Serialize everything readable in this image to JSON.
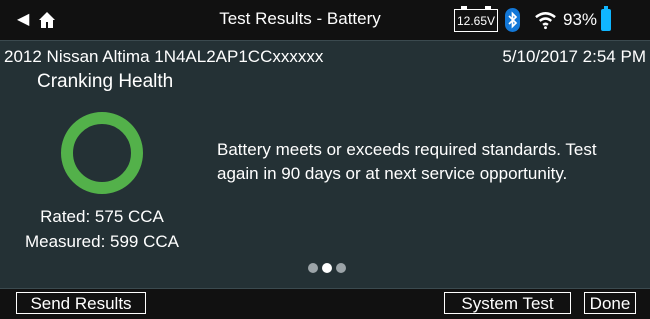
{
  "app": {
    "title": "Test Results - Battery",
    "voltage": "12.65V",
    "wifi_strength": "full",
    "battery_percent": "93%",
    "battery_level": 0.93,
    "back_icon": "back-arrow-icon",
    "home_icon": "home-icon"
  },
  "vehicle": {
    "info": "2012 Nissan Altima 1N4AL2AP1CCxxxxxx",
    "datetime": "5/10/2017  2:54 PM"
  },
  "result": {
    "section_title": "Cranking Health",
    "status_color": "#53b14a",
    "message": "Battery meets or exceeds required standards. Test again in 90 days or at next service opportunity.",
    "rated": "Rated: 575 CCA",
    "measured": "Measured: 599 CCA"
  },
  "pager": {
    "count": 3,
    "current": 2
  },
  "footer": {
    "send_label": "Send Results",
    "system_label": "System Test",
    "done_label": "Done"
  }
}
